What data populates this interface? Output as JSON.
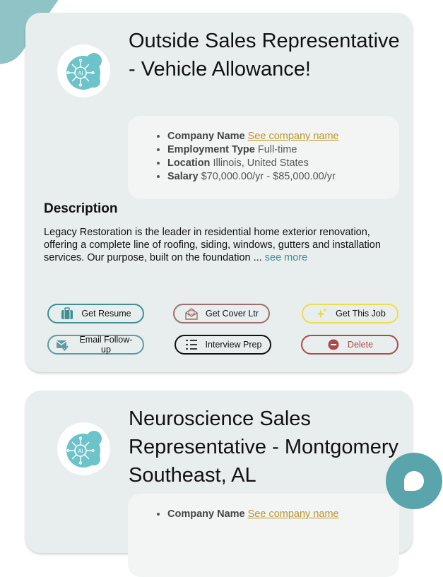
{
  "cards": [
    {
      "title": "Outside Sales Representative - Vehicle Allowance!",
      "details": {
        "company_label": "Company Name",
        "company_value": "See company name",
        "employment_label": "Employment Type",
        "employment_value": "Full-time",
        "location_label": "Location",
        "location_value": "Illinois, United States",
        "salary_label": "Salary",
        "salary_value": "$70,000.00/yr - $85,000.00/yr"
      },
      "description_heading": "Description",
      "description_text": "Legacy Restoration is the leader in residential home exterior renovation, offering a complete line of roofing, siding, windows, gutters and installation services. Our purpose, built on the foundation ...",
      "see_more": "see more",
      "actions": {
        "resume": "Get Resume",
        "cover": "Get Cover Ltr",
        "job": "Get This Job",
        "follow": "Email Follow-up",
        "prep": "Interview Prep",
        "delete": "Delete"
      }
    },
    {
      "title": "Neuroscience Sales Representative - Montgomery Southeast, AL",
      "details": {
        "company_label": "Company Name",
        "company_value": "See company name"
      }
    }
  ],
  "colors": {
    "accent": "#5aa5ab",
    "card_bg": "#e8eeee",
    "link_gold": "#b8952a",
    "delete_red": "#b04848"
  },
  "icons": {
    "logo": "ai-logo-icon",
    "resume": "briefcase-icon",
    "cover": "envelope-open-icon",
    "job": "sparkle-icon",
    "follow": "email-check-icon",
    "prep": "checklist-icon",
    "delete": "minus-circle-icon",
    "chat": "chat-bubble-icon"
  }
}
